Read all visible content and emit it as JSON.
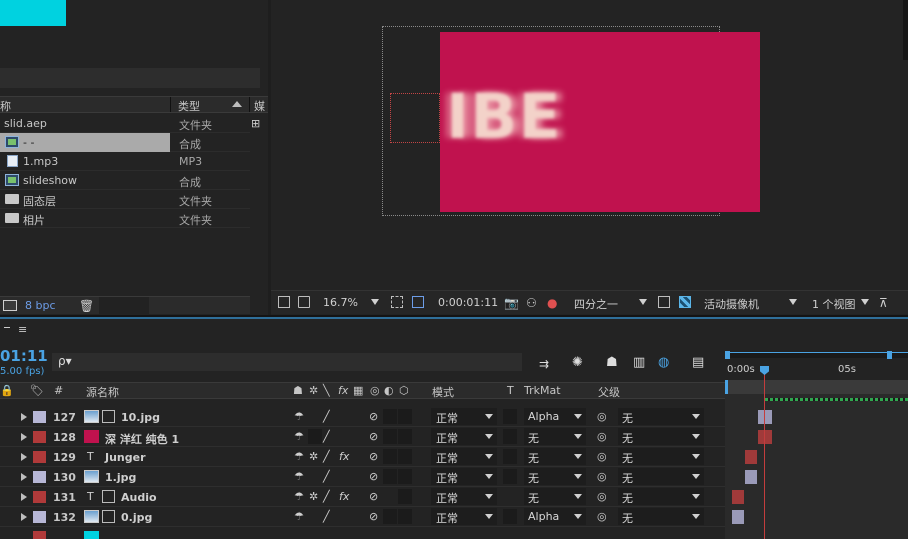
{
  "project": {
    "col_name": "称",
    "col_type": "类型",
    "col_media": "媒",
    "items": [
      {
        "name": "slid.aep",
        "type": "文件夹",
        "icon": "none"
      },
      {
        "name": "- -",
        "type": "合成",
        "icon": "comp-icon",
        "selected": true
      },
      {
        "name": "1.mp3",
        "type": "MP3",
        "icon": "audio-icon"
      },
      {
        "name": "slideshow",
        "type": "合成",
        "icon": "comp-icon"
      },
      {
        "name": "固态层",
        "type": "文件夹",
        "icon": "folder-icon"
      },
      {
        "name": "相片",
        "type": "文件夹",
        "icon": "folder-icon"
      }
    ],
    "bpc": "8 bpc"
  },
  "viewer": {
    "text_preview": "IBE",
    "solid_color": "#c0124e",
    "zoom": "16.7%",
    "timecode": "0:00:01:11",
    "resolution": "四分之一",
    "camera": "活动摄像机",
    "views": "1 个视图"
  },
  "timeline": {
    "tab_menu": "≡",
    "timecode": "01:11",
    "fps": "5.00 fps)",
    "search_placeholder": "ρ▾",
    "col_num": "#",
    "col_source": "源名称",
    "col_mode": "模式",
    "col_t": "T",
    "col_trkmat": "TrkMat",
    "col_parent": "父级",
    "ruler_start": "0:00s",
    "ruler_5s": "05s",
    "rows": [
      {
        "num": "127",
        "name": "10.jpg",
        "label_color": "#b7b7d6",
        "type": "image",
        "mode": "正常",
        "trkmat": "Alpha",
        "parent": "无"
      },
      {
        "num": "128",
        "name": "深 洋红 纯色 1",
        "label_color": "#b03a3a",
        "type": "solid",
        "mode": "正常",
        "trkmat": "无",
        "parent": "无"
      },
      {
        "num": "129",
        "name": "Junger",
        "label_color": "#b03a3a",
        "type": "text",
        "mode": "正常",
        "trkmat": "无",
        "parent": "无"
      },
      {
        "num": "130",
        "name": "1.jpg",
        "label_color": "#b7b7d6",
        "type": "image",
        "mode": "正常",
        "trkmat": "无",
        "parent": "无"
      },
      {
        "num": "131",
        "name": "Audio",
        "label_color": "#b03a3a",
        "type": "text",
        "mode": "正常",
        "trkmat": "无",
        "parent": "无"
      },
      {
        "num": "132",
        "name": "0.jpg",
        "label_color": "#b7b7d6",
        "type": "image",
        "mode": "正常",
        "trkmat": "Alpha",
        "parent": "无"
      }
    ]
  },
  "colors": {
    "accent_blue": "#4aa3e3",
    "panel_bg": "#232323",
    "solid_magenta": "#c0124e",
    "label_red": "#b03a3a",
    "label_lavender": "#b7b7d6"
  }
}
